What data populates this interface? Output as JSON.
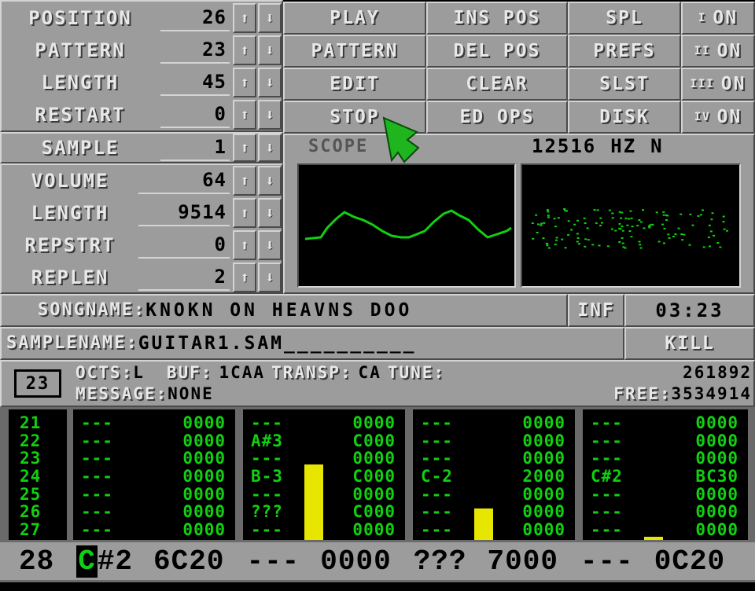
{
  "song": {
    "position": {
      "label": "POSITION",
      "value": "26"
    },
    "pattern": {
      "label": "PATTERN",
      "value": "23"
    },
    "length": {
      "label": "LENGTH",
      "value": "45"
    },
    "restart": {
      "label": "RESTART",
      "value": "0"
    }
  },
  "sample": {
    "sample": {
      "label": "SAMPLE",
      "value": "1"
    },
    "volume": {
      "label": "VOLUME",
      "value": "64"
    },
    "length": {
      "label": "LENGTH",
      "value": "9514"
    },
    "repstrt": {
      "label": "REPSTRT",
      "value": "0"
    },
    "replen": {
      "label": "REPLEN",
      "value": "2"
    }
  },
  "arrows": {
    "up": "⬆",
    "down": "⬇"
  },
  "buttons": {
    "play": "PLAY",
    "pattern": "PATTERN",
    "edit": "EDIT",
    "stop": "STOP",
    "ins_pos": "INS POS",
    "del_pos": "DEL POS",
    "clear": "CLEAR",
    "ed_ops": "ED OPS",
    "spl": "SPL",
    "prefs": "PREFS",
    "slst": "SLST",
    "disk": "DISK"
  },
  "channels": [
    {
      "num": "I",
      "state": "ON"
    },
    {
      "num": "II",
      "state": "ON"
    },
    {
      "num": "III",
      "state": "ON"
    },
    {
      "num": "IV",
      "state": "ON"
    }
  ],
  "scope": {
    "label": "SCOPE",
    "rate": "12516",
    "unit": "HZ",
    "mode": "N"
  },
  "songname": {
    "label": "SONGNAME:",
    "value": "KNOKN ON HEAVNS DOO"
  },
  "inf": "INF",
  "time": "03:23",
  "samplename": {
    "label": "SAMPLENAME:",
    "value": "GUITAR1.SAM__________"
  },
  "kill": "KILL",
  "info": {
    "pattern_num": "23",
    "octs_label": "OCTS:",
    "octs_value": "L",
    "buf_label": "BUF:",
    "buf_value": "1CAA",
    "transp_label": "TRANSP:",
    "transp_value": "CA",
    "tune_label": "TUNE:",
    "tune_value": "261892",
    "message_label": "MESSAGE:",
    "message_value": "NONE",
    "free_label": "FREE:",
    "free_value": "3534914"
  },
  "rows": [
    "21",
    "22",
    "23",
    "24",
    "25",
    "26",
    "27"
  ],
  "tracks": [
    {
      "rows": [
        [
          "---",
          "0000"
        ],
        [
          "---",
          "0000"
        ],
        [
          "---",
          "0000"
        ],
        [
          "---",
          "0000"
        ],
        [
          "---",
          "0000"
        ],
        [
          "---",
          "0000"
        ],
        [
          "---",
          "0000"
        ]
      ],
      "vu": 0
    },
    {
      "rows": [
        [
          "---",
          "0000"
        ],
        [
          "A#3",
          "C000"
        ],
        [
          "---",
          "0000"
        ],
        [
          "B-3",
          "C000"
        ],
        [
          "---",
          "0000"
        ],
        [
          "???",
          "C000"
        ],
        [
          "---",
          "0000"
        ]
      ],
      "vu": 0.6
    },
    {
      "rows": [
        [
          "---",
          "0000"
        ],
        [
          "---",
          "0000"
        ],
        [
          "---",
          "0000"
        ],
        [
          "C-2",
          "2000"
        ],
        [
          "---",
          "0000"
        ],
        [
          "---",
          "0000"
        ],
        [
          "---",
          "0000"
        ]
      ],
      "vu": 0.25
    },
    {
      "rows": [
        [
          "---",
          "0000"
        ],
        [
          "---",
          "0000"
        ],
        [
          "---",
          "0000"
        ],
        [
          "C#2",
          "BC30"
        ],
        [
          "---",
          "0000"
        ],
        [
          "---",
          "0000"
        ],
        [
          "---",
          "0000"
        ]
      ],
      "vu": 0.02
    }
  ],
  "edit_line": {
    "row": "28",
    "cursor_char": "C",
    "cells": [
      {
        "note": "#2",
        "fx": "6C20"
      },
      {
        "note": "---",
        "fx": "0000"
      },
      {
        "note": "???",
        "fx": "7000"
      },
      {
        "note": "---",
        "fx": "0C20"
      }
    ]
  },
  "colors": {
    "panel": "#9c9c9c",
    "text_green": "#11d011",
    "vu_yellow": "#e6e600",
    "pointer": "#1fb51f"
  }
}
